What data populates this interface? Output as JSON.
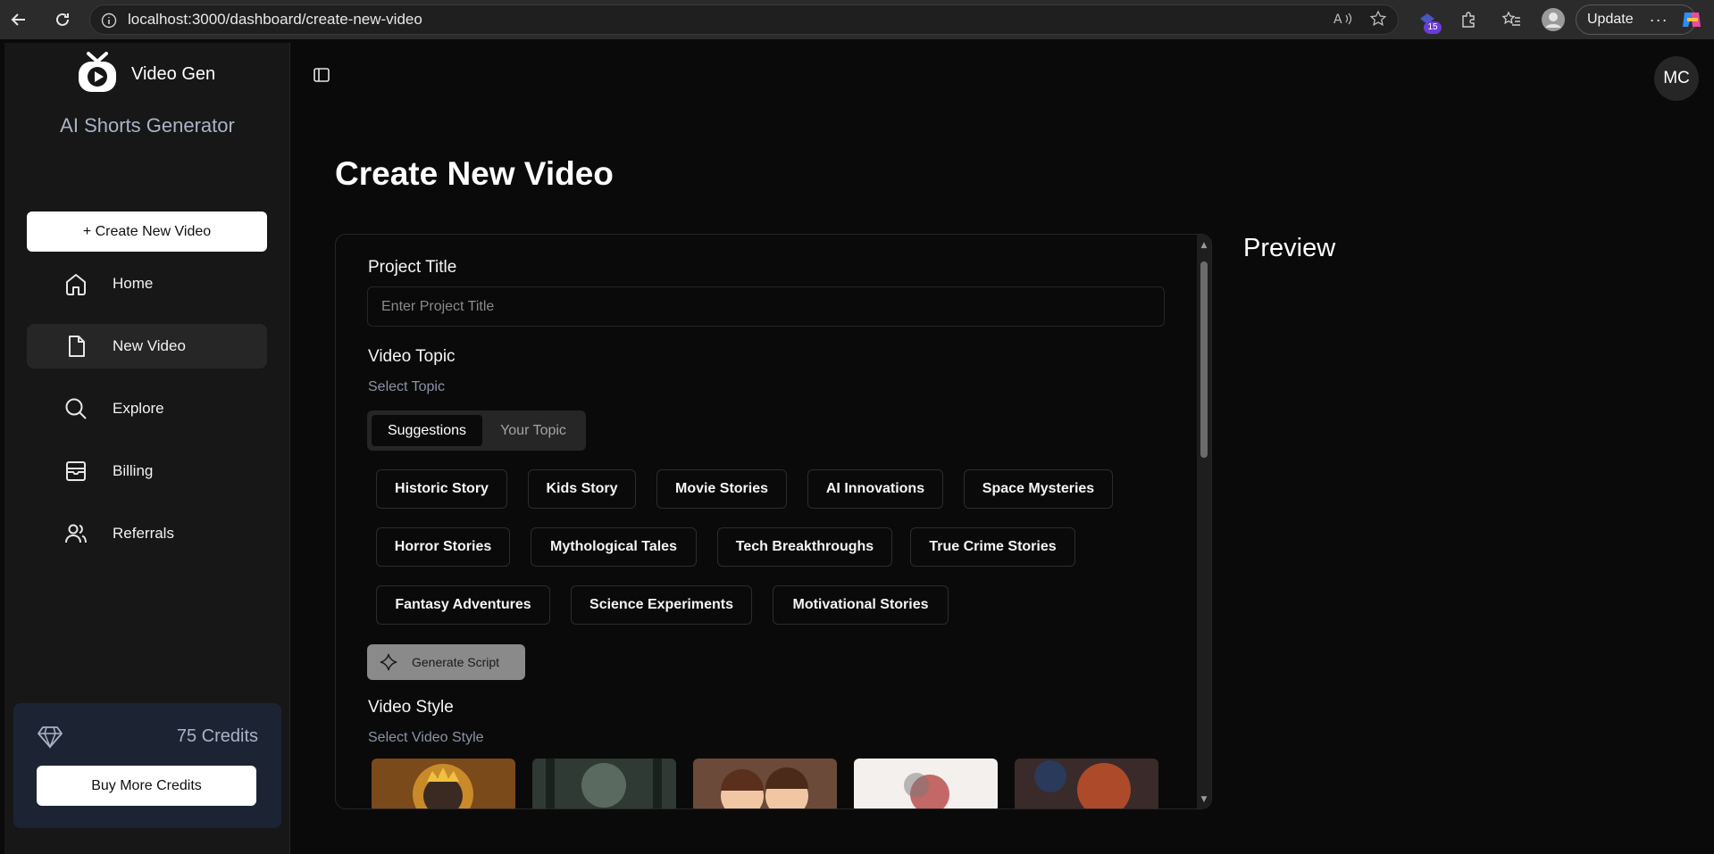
{
  "browser": {
    "url": "localhost:3000/dashboard/create-new-video",
    "extension_badge": "15",
    "update_label": "Update"
  },
  "sidebar": {
    "brand": "Video Gen",
    "subtitle": "AI Shorts Generator",
    "create_button": "+ Create New Video",
    "items": [
      {
        "label": "Home",
        "icon": "home-icon"
      },
      {
        "label": "New Video",
        "icon": "file-icon",
        "active": true
      },
      {
        "label": "Explore",
        "icon": "search-icon"
      },
      {
        "label": "Billing",
        "icon": "wallet-icon"
      },
      {
        "label": "Referrals",
        "icon": "users-icon"
      }
    ],
    "credits": "75 Credits",
    "buy_button": "Buy More Credits"
  },
  "header": {
    "avatar_initials": "MC"
  },
  "main": {
    "title": "Create New Video",
    "preview_title": "Preview",
    "project_title_label": "Project Title",
    "project_title_placeholder": "Enter Project Title",
    "topic_label": "Video Topic",
    "topic_sub": "Select Topic",
    "tabs": [
      "Suggestions",
      "Your Topic"
    ],
    "topics": [
      "Historic Story",
      "Kids Story",
      "Movie Stories",
      "AI Innovations",
      "Space Mysteries",
      "Horror Stories",
      "Mythological Tales",
      "Tech Breakthroughs",
      "True Crime Stories",
      "Fantasy Adventures",
      "Science Experiments",
      "Motivational Stories"
    ],
    "generate_button": "Generate Script",
    "style_label": "Video Style",
    "style_sub": "Select Video Style"
  },
  "colors": {
    "background": "#0a0a0a",
    "sidebar": "#171717",
    "credits_card": "#1c2433",
    "muted_text": "#8a93a6"
  }
}
